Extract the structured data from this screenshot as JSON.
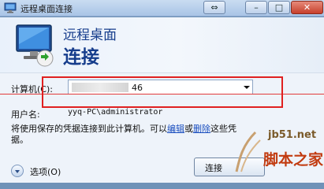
{
  "window": {
    "title": "远程桌面连接",
    "restore_label": "⇔",
    "minimize_label": "–",
    "maximize_label": "□",
    "close_label": "✕"
  },
  "header": {
    "line1": "远程桌面",
    "line2": "连接"
  },
  "form": {
    "computer_label": "计算机(C):",
    "computer_value_visible": "46",
    "username_label": "用户名:",
    "username_value": "yyq-PC\\administrator",
    "info_prefix": "将使用保存的凭据连接到此计算机。可以",
    "edit_link": "编辑",
    "info_or": "或",
    "delete_link": "删除",
    "info_suffix": "这些凭据。"
  },
  "footer": {
    "options_label": "选项(O)",
    "connect_label": "连接"
  },
  "watermark": {
    "url": "jb51.net",
    "text": "脚本之家"
  },
  "colors": {
    "annotation_red": "#e02020",
    "header_text": "#163d8c",
    "link": "#1b4fbf"
  }
}
